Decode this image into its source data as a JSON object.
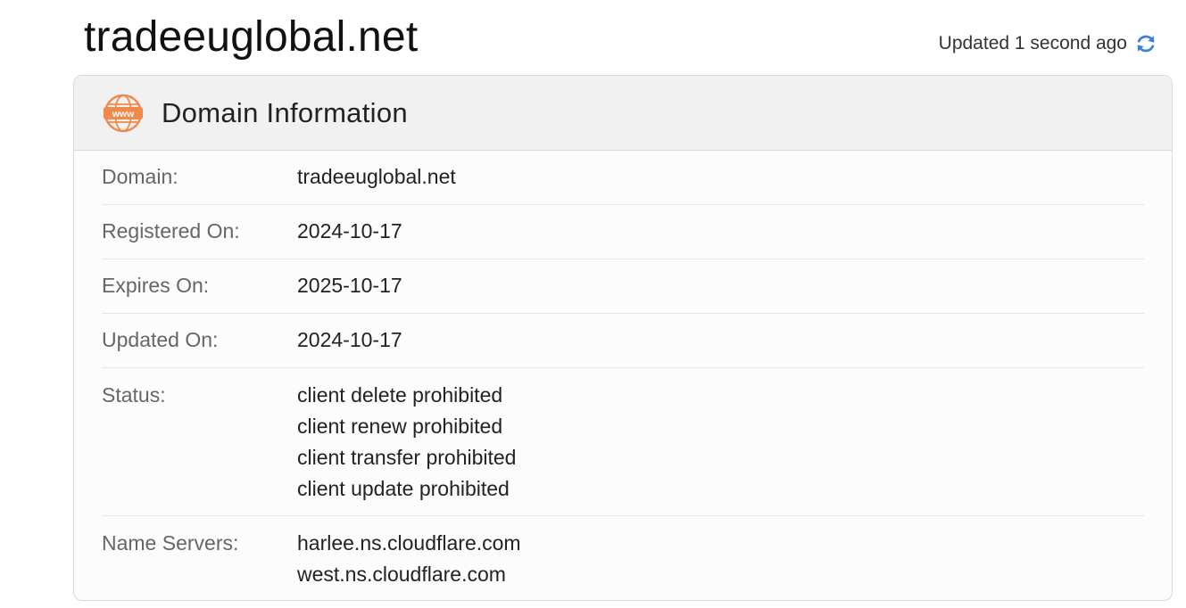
{
  "header": {
    "domain_title": "tradeeuglobal.net",
    "updated_text": "Updated 1 second ago",
    "refresh_icon": "refresh-icon"
  },
  "card": {
    "icon": "www-globe-icon",
    "title": "Domain Information",
    "rows": [
      {
        "label": "Domain:",
        "value": "tradeeuglobal.net"
      },
      {
        "label": "Registered On:",
        "value": "2024-10-17"
      },
      {
        "label": "Expires On:",
        "value": "2025-10-17"
      },
      {
        "label": "Updated On:",
        "value": "2024-10-17"
      }
    ],
    "status": {
      "label": "Status:",
      "values": [
        "client delete prohibited",
        "client renew prohibited",
        "client transfer prohibited",
        "client update prohibited"
      ]
    },
    "name_servers": {
      "label": "Name Servers:",
      "values": [
        "harlee.ns.cloudflare.com",
        "west.ns.cloudflare.com"
      ]
    }
  },
  "colors": {
    "accent_orange": "#f08a4b",
    "refresh_blue": "#3b82d6"
  }
}
